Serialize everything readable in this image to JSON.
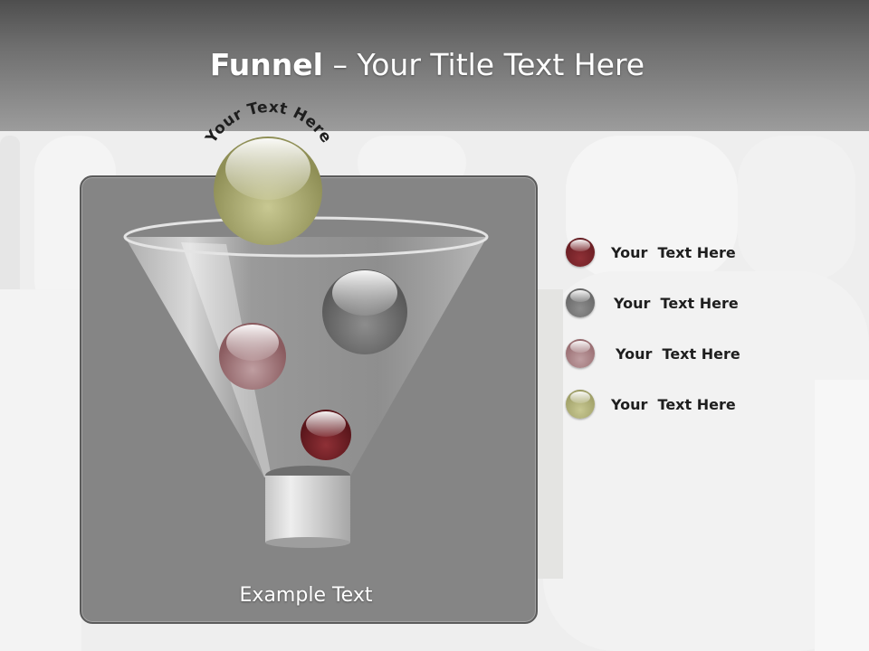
{
  "slide": {
    "title_bold": "Funnel",
    "title_separator": " – ",
    "title_rest": "Your Title Text Here",
    "arc_label": "Your Text Here",
    "example_text": "Example Text"
  },
  "legend": [
    {
      "label": "Your  Text Here",
      "color": "#6e1f24",
      "icon": "dark-red-ball-icon"
    },
    {
      "label": "Your  Text Here",
      "color": "#6f6f6f",
      "icon": "gray-ball-icon"
    },
    {
      "label": "Your  Text Here",
      "color": "#a07074",
      "icon": "rose-ball-icon"
    },
    {
      "label": "Your  Text Here",
      "color": "#9a9a6e",
      "icon": "olive-ball-icon"
    }
  ],
  "colors": {
    "dark_red": "#6e1f24",
    "gray": "#6f6f6f",
    "rose": "#a07074",
    "olive": "#9a9a6e"
  }
}
